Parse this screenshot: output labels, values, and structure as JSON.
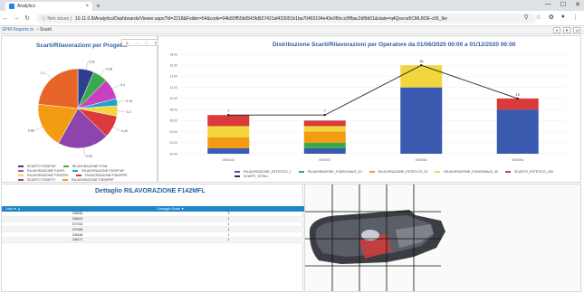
{
  "browser": {
    "tab_title": "Analytics",
    "new_tab": "+",
    "win_min": "—",
    "win_max": "☐",
    "win_close": "✕",
    "insecure_label": "Non sicuro",
    "url": "10.11.0.8/Analytics/Dashboards/Viewer.aspx?Id=2218&Folder=54&code=04b92ff55b0543fd927431af433051b1ba70460194e43e0f9ccc0ffbac2df9d01&state=q4Qsvcw5CML8OE-c06_9w"
  },
  "app": {
    "brand": "SPM Reports ts",
    "crumb": "Scarti"
  },
  "pie": {
    "title": "Scarti/Rilavorazioni per Progetto",
    "labels": [
      "0.31",
      "0.28",
      "0.4",
      "0.14",
      "0.2",
      "0.43",
      "0.99",
      "0.88",
      "1.1"
    ],
    "legend": [
      {
        "label": "SCARTO F30SFMF",
        "color": "#2e3f8f"
      },
      {
        "label": "RILAVORAZIONE F70A",
        "color": "#3aa84e"
      },
      {
        "label": "RILAVORAZIONE F420FL",
        "color": "#c83fc0"
      },
      {
        "label": "RILAVORAZIONE F30SP MF",
        "color": "#1fa4c9"
      },
      {
        "label": "RILAVORAZIONE F30SP/FL",
        "color": "#f1d63d"
      },
      {
        "label": "RILAVORAZIONE F3EMPRF",
        "color": "#d93a3a"
      },
      {
        "label": "SCARTO F30SP/TI",
        "color": "#8e44ad"
      },
      {
        "label": "RILAVORAZIONE F3EMPRF",
        "color": "#f39c12"
      }
    ]
  },
  "bar": {
    "title": "Distribuzione Scarti/Rilavorazioni per Operatore da 01/06/2020 00:00 a 01/12/2020 00:00",
    "legend": [
      {
        "label": "RILAVORAZIONE_ESTETICO_1",
        "color": "#3a5ab0"
      },
      {
        "label": "RILAVORAZIONE_FUNZIONALE_10",
        "color": "#3aa84e"
      },
      {
        "label": "RILAVORAZIONE_ESTETICO_20",
        "color": "#f39c12"
      },
      {
        "label": "RILAVORAZIONE_FUNZIONALE_40",
        "color": "#f1d63d"
      },
      {
        "label": "SCARTO_ESTETICO_100",
        "color": "#d93a3a"
      },
      {
        "label": "SCARTI_TOTALI",
        "color": "#333333"
      }
    ]
  },
  "chart_data": {
    "type": "bar",
    "title": "Distribuzione Scarti/Rilavorazioni per Operatore da 01/06/2020 00:00 a 01/12/2020 00:00",
    "categories": [
      "0000044",
      "0000072",
      "0000084",
      "0000064"
    ],
    "ylim": [
      0,
      18
    ],
    "yticks": [
      "00.00",
      "02.00",
      "04.00",
      "06.00",
      "08.00",
      "10.00",
      "12.00",
      "14.00",
      "16.00",
      "18.00"
    ],
    "series": [
      {
        "name": "RILAVORAZIONE_ESTETICO_1",
        "color": "#3a5ab0",
        "values": [
          1,
          1,
          12,
          8
        ]
      },
      {
        "name": "RILAVORAZIONE_FUNZIONALE_10",
        "color": "#3aa84e",
        "values": [
          0,
          1,
          0,
          0
        ]
      },
      {
        "name": "RILAVORAZIONE_ESTETICO_20",
        "color": "#f39c12",
        "values": [
          2,
          2,
          0,
          0
        ]
      },
      {
        "name": "RILAVORAZIONE_FUNZIONALE_40",
        "color": "#f1d63d",
        "values": [
          2,
          1,
          4,
          0
        ]
      },
      {
        "name": "SCARTO_ESTETICO_100",
        "color": "#d93a3a",
        "values": [
          2,
          1,
          0,
          2
        ]
      }
    ],
    "line": {
      "name": "SCARTI_TOTALI",
      "color": "#222222",
      "values": [
        7,
        7,
        16,
        10
      ]
    },
    "data_labels": [
      "7",
      "7",
      "16",
      "10"
    ]
  },
  "grid": {
    "title": "Dettaglio RILAVORAZIONE F142MFL",
    "columns": [
      "Lotto ▼ ▲",
      "Conteggio Scarti ▼"
    ],
    "rows": [
      [
        "205056",
        "3"
      ],
      [
        "206603",
        "1"
      ],
      [
        "207264",
        "1"
      ],
      [
        "207568",
        "1"
      ],
      [
        "208488",
        "1"
      ],
      [
        "208471",
        "1"
      ]
    ]
  }
}
